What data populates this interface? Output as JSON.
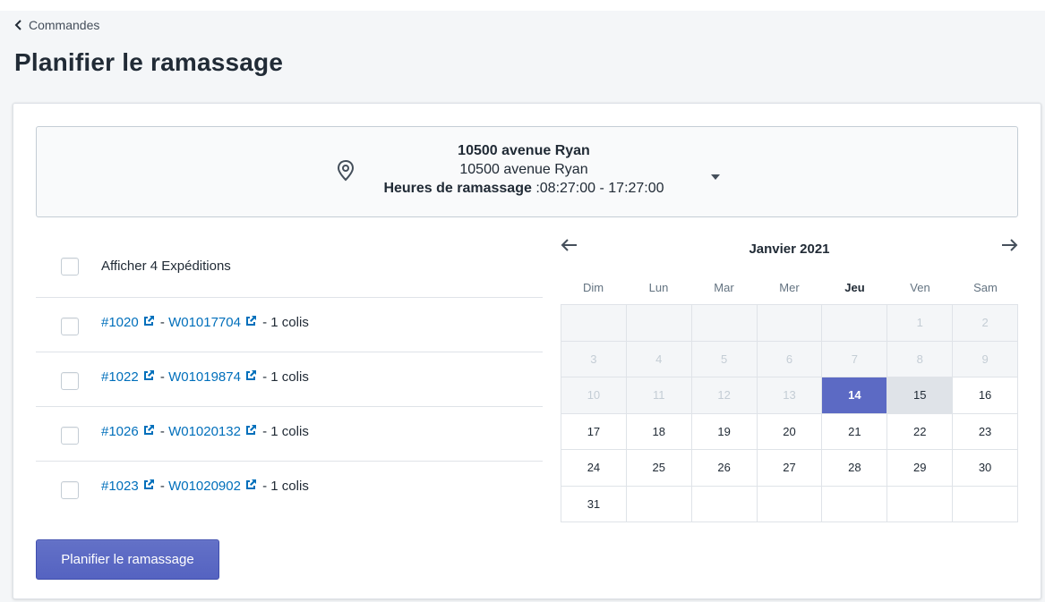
{
  "breadcrumb": {
    "label": "Commandes"
  },
  "page_title": "Planifier le ramassage",
  "location": {
    "name": "10500 avenue Ryan",
    "address": "10500 avenue Ryan",
    "hours_label": "Heures de ramassage",
    "hours_value": " :08:27:00 - 17:27:00",
    "icon": "map-pin-icon"
  },
  "shipments": {
    "select_all_label": "Afficher 4 Expéditions",
    "rows": [
      {
        "order": "#1020",
        "tracking": "W01017704",
        "packages": " - 1 colis"
      },
      {
        "order": "#1022",
        "tracking": "W01019874",
        "packages": " - 1 colis"
      },
      {
        "order": "#1026",
        "tracking": "W01020132",
        "packages": " - 1 colis"
      },
      {
        "order": "#1023",
        "tracking": "W01020902",
        "packages": " - 1 colis"
      }
    ],
    "separator": " - "
  },
  "calendar": {
    "month_label": "Janvier 2021",
    "weekdays": [
      "Dim",
      "Lun",
      "Mar",
      "Mer",
      "Jeu",
      "Ven",
      "Sam"
    ],
    "today_weekday_index": 4,
    "selected_day": 14,
    "weeks": [
      [
        "",
        "",
        "",
        "",
        "",
        "1",
        "2"
      ],
      [
        "3",
        "4",
        "5",
        "6",
        "7",
        "8",
        "9"
      ],
      [
        "10",
        "11",
        "12",
        "13",
        "14",
        "15",
        "16"
      ],
      [
        "17",
        "18",
        "19",
        "20",
        "21",
        "22",
        "23"
      ],
      [
        "24",
        "25",
        "26",
        "27",
        "28",
        "29",
        "30"
      ],
      [
        "31",
        "",
        "",
        "",
        "",
        "",
        ""
      ]
    ],
    "disabled_through_day": 13,
    "hover_day": 15
  },
  "actions": {
    "submit_label": "Planifier le ramassage"
  },
  "colors": {
    "primary": "#5c6ac4",
    "link": "#006fbb",
    "page_bg": "#f4f6f8",
    "border": "#dfe3e8"
  }
}
